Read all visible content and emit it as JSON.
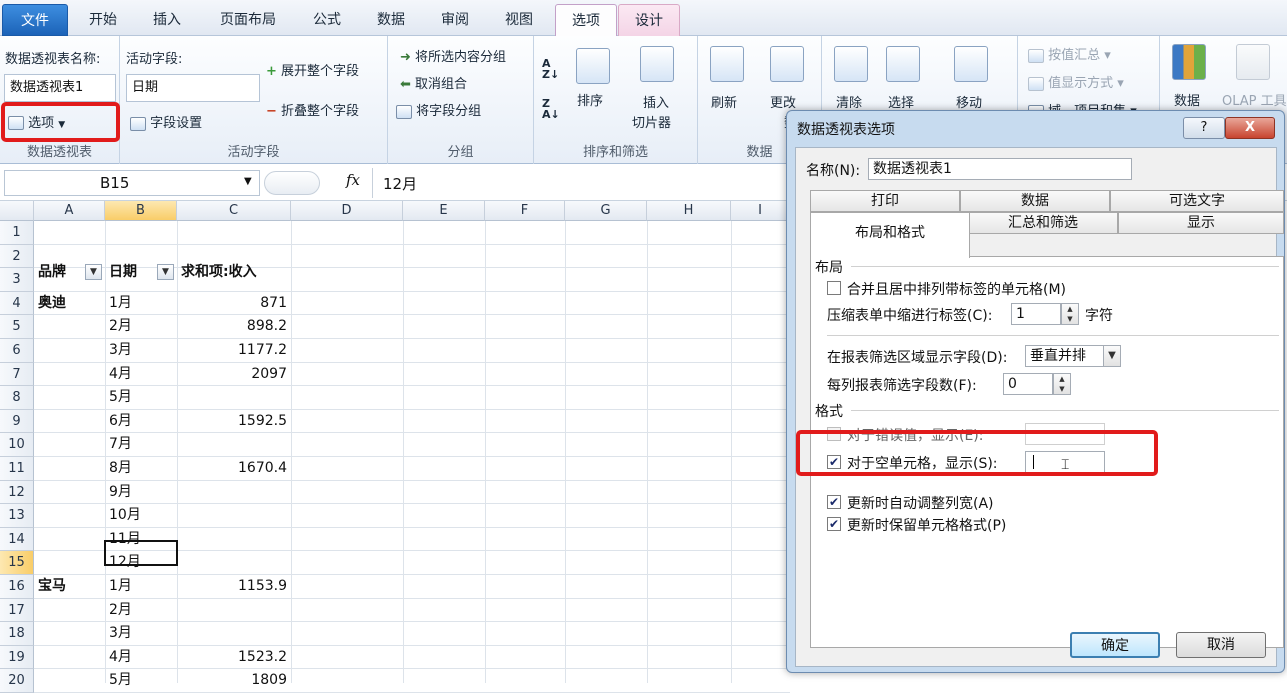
{
  "ribbon": {
    "tabs": [
      "文件",
      "开始",
      "插入",
      "页面布局",
      "公式",
      "数据",
      "审阅",
      "视图",
      "选项",
      "设计"
    ],
    "pivot_name_label": "数据透视表名称:",
    "pivot_name_value": "数据透视表1",
    "options_button": "选项",
    "group_pivot": "数据透视表",
    "active_field_label": "活动字段:",
    "active_field_value": "日期",
    "field_settings": "字段设置",
    "expand_field": "展开整个字段",
    "collapse_field": "折叠整个字段",
    "group_active_field": "活动字段",
    "group_selection": "将所选内容分组",
    "ungroup": "取消组合",
    "group_field": "将字段分组",
    "group_group": "分组",
    "sort": "排序",
    "insert_slicer": "插入",
    "insert_slicer_2": "切片器",
    "group_sort_filter": "排序和筛选",
    "refresh": "刷新",
    "change_source": "更改",
    "change_source_2": "数据",
    "group_data": "数据",
    "clear": "清除",
    "select": "选择",
    "move": "移动",
    "summarize_by": "按值汇总",
    "show_values_as": "值显示方式",
    "fields_items_sets": "域、项目和集",
    "data_btn": "数据",
    "olap_tools": "OLAP 工具"
  },
  "formula_bar": {
    "name_box": "B15",
    "fx": "fx",
    "value": "12月"
  },
  "grid": {
    "columns": [
      "A",
      "B",
      "C",
      "D",
      "E",
      "F",
      "G",
      "H",
      "I"
    ],
    "rows": [
      "1",
      "2",
      "3",
      "4",
      "5",
      "6",
      "7",
      "8",
      "9",
      "10",
      "11",
      "12",
      "13",
      "14",
      "15",
      "16",
      "17",
      "18",
      "19",
      "20"
    ],
    "header": {
      "brand": "品牌",
      "date": "日期",
      "sum": "求和项:收入"
    },
    "data": [
      {
        "brand": "奥迪",
        "date": "1月",
        "value": "871"
      },
      {
        "brand": "",
        "date": "2月",
        "value": "898.2"
      },
      {
        "brand": "",
        "date": "3月",
        "value": "1177.2"
      },
      {
        "brand": "",
        "date": "4月",
        "value": "2097"
      },
      {
        "brand": "",
        "date": "5月",
        "value": ""
      },
      {
        "brand": "",
        "date": "6月",
        "value": "1592.5"
      },
      {
        "brand": "",
        "date": "7月",
        "value": ""
      },
      {
        "brand": "",
        "date": "8月",
        "value": "1670.4"
      },
      {
        "brand": "",
        "date": "9月",
        "value": ""
      },
      {
        "brand": "",
        "date": "10月",
        "value": ""
      },
      {
        "brand": "",
        "date": "11月",
        "value": ""
      },
      {
        "brand": "",
        "date": "12月",
        "value": ""
      },
      {
        "brand": "宝马",
        "date": "1月",
        "value": "1153.9"
      },
      {
        "brand": "",
        "date": "2月",
        "value": ""
      },
      {
        "brand": "",
        "date": "3月",
        "value": ""
      },
      {
        "brand": "",
        "date": "4月",
        "value": "1523.2"
      },
      {
        "brand": "",
        "date": "5月",
        "value": "1809"
      }
    ]
  },
  "dialog": {
    "title": "数据透视表选项",
    "help": "?",
    "close": "X",
    "name_label": "名称(N):",
    "name_value": "数据透视表1",
    "tabs_row1": [
      "打印",
      "数据",
      "可选文字"
    ],
    "tabs_row2": [
      "布局和格式",
      "汇总和筛选",
      "显示"
    ],
    "layout_section": "布局",
    "merge_center": "合并且居中排列带标签的单元格(M)",
    "indent_label": "压缩表单中缩进行标签(C):",
    "indent_value": "1",
    "indent_unit": "字符",
    "filter_area_label": "在报表筛选区域显示字段(D):",
    "filter_area_value": "垂直并排",
    "filter_fields_label": "每列报表筛选字段数(F):",
    "filter_fields_value": "0",
    "format_section": "格式",
    "error_show": "对于错误值，显示(E):",
    "empty_show": "对于空单元格，显示(S):",
    "autofit": "更新时自动调整列宽(A)",
    "preserve": "更新时保留单元格格式(P)",
    "ok": "确定",
    "cancel": "取消"
  }
}
